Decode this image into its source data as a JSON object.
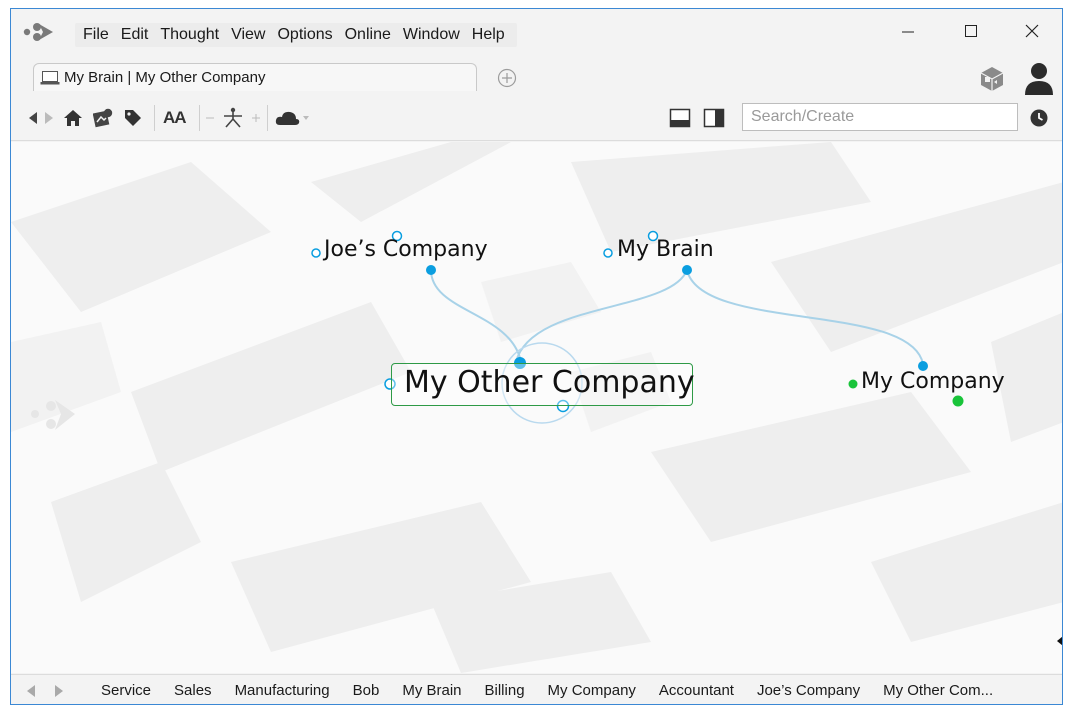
{
  "menu": [
    "File",
    "Edit",
    "Thought",
    "View",
    "Options",
    "Online",
    "Window",
    "Help"
  ],
  "tab": {
    "label": "My Brain | My Other Company"
  },
  "search": {
    "placeholder": "Search/Create"
  },
  "toolbar": {
    "font_size_label": "AA"
  },
  "plex": {
    "active_thought": "My Other Company",
    "parents": [
      "Joe’s Company",
      "My Brain"
    ],
    "jump": [
      "My Company"
    ]
  },
  "history": [
    "Service",
    "Sales",
    "Manufacturing",
    "Bob",
    "My Brain",
    "Billing",
    "My Company",
    "Accountant",
    "Joe’s Company",
    "My Other Com..."
  ],
  "colors": {
    "link": "#a8d2e8",
    "node_blue": "#0a9ee0",
    "node_green": "#19c43a",
    "active_border": "#2e9a46",
    "window_border": "#3b88d4"
  },
  "icons": [
    "app-logo-icon",
    "minimize-icon",
    "maximize-icon",
    "close-icon",
    "laptop-icon",
    "add-tab-icon",
    "plex-icon",
    "user-icon",
    "back-arrow-icon",
    "forward-arrow-icon",
    "home-icon",
    "brain-icon",
    "tag-icon",
    "layout-icon",
    "cloud-icon",
    "panel-bottom-icon",
    "panel-right-icon",
    "clock-icon"
  ]
}
